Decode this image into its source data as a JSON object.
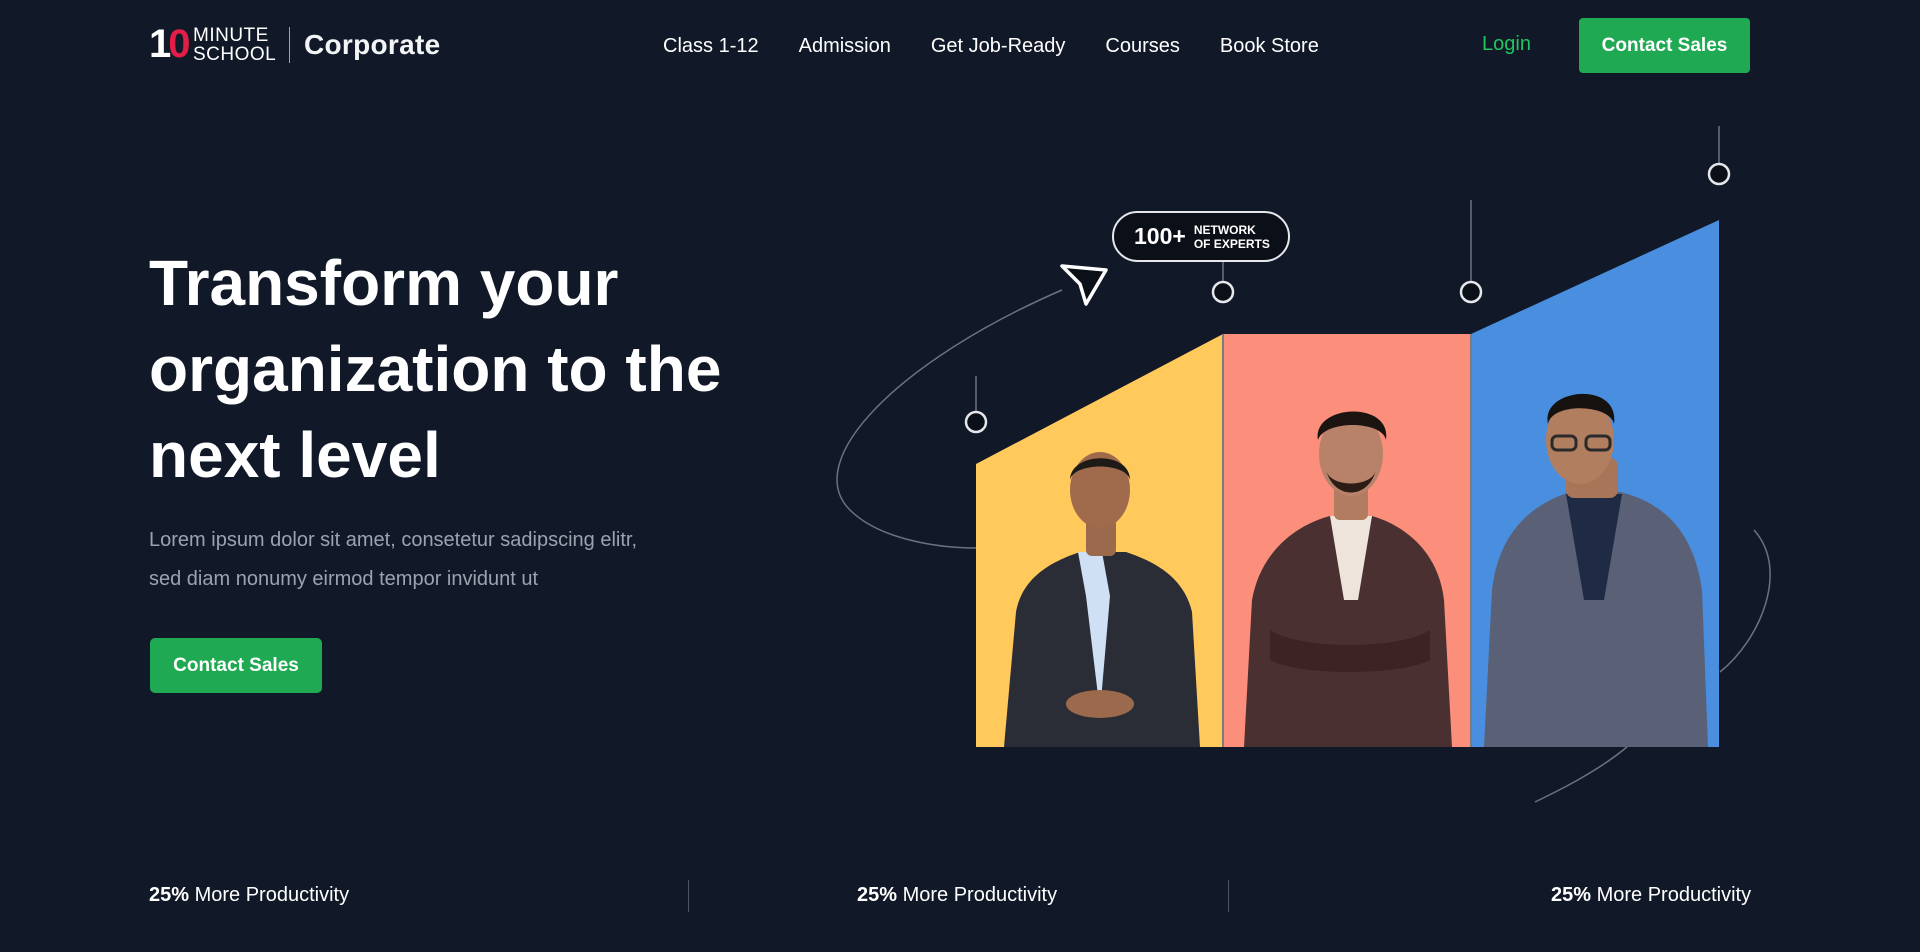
{
  "header": {
    "logo": {
      "number": "10",
      "word_top": "MINUTE",
      "word_bottom": "SCHOOL",
      "product": "Corporate"
    },
    "nav": [
      {
        "label": "Class 1-12"
      },
      {
        "label": "Admission"
      },
      {
        "label": "Get Job-Ready"
      },
      {
        "label": "Courses"
      },
      {
        "label": "Book Store"
      }
    ],
    "login_label": "Login",
    "cta_label": "Contact Sales"
  },
  "hero": {
    "title": "Transform your organization to the next level",
    "subtitle": "Lorem ipsum dolor sit amet, consetetur sadipscing elitr, sed diam nonumy eirmod tempor invidunt ut",
    "cta_label": "Contact Sales"
  },
  "graphic": {
    "badge_number": "100+",
    "badge_text": "NETWORK\nOF EXPERTS",
    "panels": [
      {
        "color": "#ffc95c"
      },
      {
        "color": "#fc8f7c"
      },
      {
        "color": "#4a8ee0"
      }
    ]
  },
  "stats": [
    {
      "value": "25%",
      "label": "More Productivity"
    },
    {
      "value": "25%",
      "label": "More Productivity"
    },
    {
      "value": "25%",
      "label": "More Productivity"
    }
  ],
  "colors": {
    "background": "#111827",
    "accent_green": "#1ea952",
    "login_green": "#22c55e",
    "muted_text": "#9ca3af"
  }
}
